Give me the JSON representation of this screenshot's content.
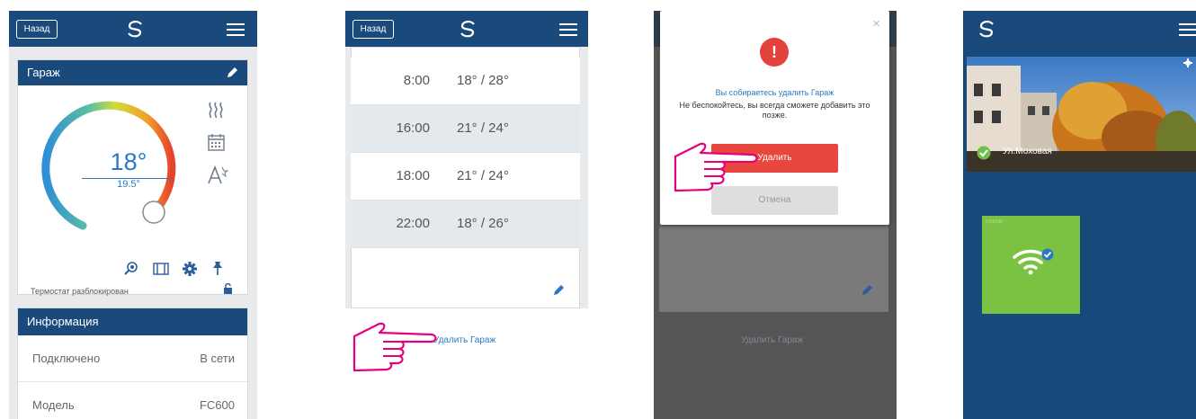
{
  "panel1": {
    "back_label": "Назад",
    "zone_name": "Гараж",
    "setpoint": "18°",
    "actual_temp": "19.5°",
    "lock_status": "Термостат разблокирован",
    "info_header": "Информация",
    "info_rows": [
      {
        "key": "Подключено",
        "value": "В сети"
      },
      {
        "key": "Модель",
        "value": "FC600"
      }
    ]
  },
  "panel2": {
    "back_label": "Назад",
    "schedule": [
      {
        "time": "8:00",
        "temps": "18° / 28°"
      },
      {
        "time": "16:00",
        "temps": "21° / 24°"
      },
      {
        "time": "18:00",
        "temps": "21° / 24°"
      },
      {
        "time": "22:00",
        "temps": "18° / 26°"
      }
    ],
    "delete_zone_link": "Удалить Гараж"
  },
  "panel3": {
    "close_symbol": "×",
    "alert_symbol": "!",
    "dialog_title": "Вы собираетесь удалить Гараж",
    "dialog_message": "Не беспокойтесь, вы всегда сможете добавить это позже.",
    "delete_label": "Удалить",
    "cancel_label": "Отмена",
    "background_link": "Удалить Гараж"
  },
  "panel4": {
    "location_name": "Ул.Моховая",
    "tile_label": "UGE600"
  },
  "colors": {
    "header_blue": "#1a4a7c",
    "link_blue": "#2a79c2",
    "delete_red": "#e8473f",
    "tile_green": "#7cc242",
    "hand_magenta": "#e6007e"
  }
}
